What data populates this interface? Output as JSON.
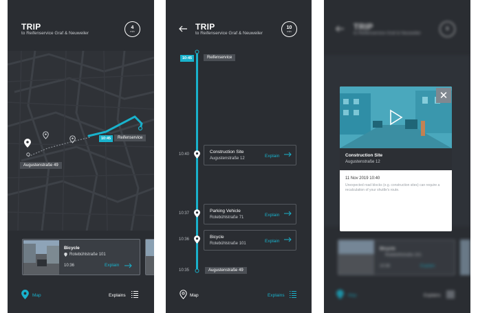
{
  "header": {
    "title": "TRIP",
    "subtitle": "to Reifenservice Graf & Neuweiler"
  },
  "screen1": {
    "clock": {
      "value": "4",
      "unit": "min"
    },
    "destination": {
      "time": "10:45",
      "label": "Reifenservice"
    },
    "origin_label": "Augustenstraße 49",
    "card": {
      "title": "Bicycle",
      "address": "Rotebühlstraße 101",
      "time": "10:36",
      "explain": "Explain"
    },
    "footer": {
      "map_label": "Map",
      "explains_label": "Explains"
    }
  },
  "screen2": {
    "clock": {
      "value": "10",
      "unit": "min"
    },
    "top": {
      "time": "10:45",
      "label": "Reifenservice"
    },
    "events": [
      {
        "time": "10:40",
        "title": "Construction Site",
        "address": "Augustenstraße 12",
        "explain": "Explain"
      },
      {
        "time": "10:37",
        "title": "Parking Vehicle",
        "address": "Rotebühlstraße 71",
        "explain": "Explain"
      },
      {
        "time": "10:36",
        "title": "Bicycle",
        "address": "Rotebühlstraße 101",
        "explain": "Explain"
      }
    ],
    "bottom": {
      "time": "10:35",
      "label": "Augustenstraße 49"
    },
    "footer": {
      "map_label": "Map",
      "explains_label": "Explains"
    }
  },
  "screen3": {
    "bg_header": {
      "title": "TRIP",
      "subtitle": "to Reifenservice Graf & Neuweiler",
      "clock": "5"
    },
    "bg_card": {
      "title": "Bicycle",
      "address": "Rotebühlstraße 101",
      "time": "10:36",
      "explain": "Explain"
    },
    "bg_footer": {
      "map_label": "Map",
      "explains_label": "Explains"
    },
    "modal": {
      "title": "Construction Site",
      "address": "Augustenstraße 12",
      "date": "11 Nov 2019  10:40",
      "body": "Unexpected road blocks (e.g. construction sites) can require a recalculation of your shuttle's route."
    }
  },
  "colors": {
    "accent": "#19b2cc",
    "background": "#2a2d32",
    "panel": "#3a3e44"
  },
  "icons": [
    "clock-icon",
    "back-arrow-icon",
    "location-pin-icon",
    "arrow-right-icon",
    "list-icon",
    "play-icon",
    "close-icon"
  ]
}
